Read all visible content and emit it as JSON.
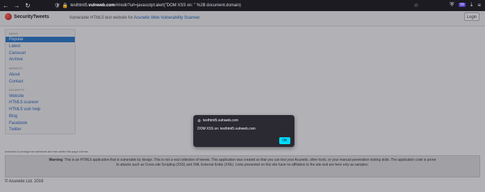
{
  "browser": {
    "nav": {
      "back": "←",
      "forward": "→",
      "reload": "↻"
    },
    "url": {
      "prefix": "testhtml5.",
      "host": "vulnweb.com",
      "path": "/#/redir?url=javascript:alert(\"DOM XSS on: \" %2B document.domain)"
    },
    "star": "☆",
    "right_icons": {
      "shield": "⛨",
      "extension_badge": "59",
      "download": "⤓",
      "menu": "≡"
    }
  },
  "site": {
    "logo_text": "SecurityTweets",
    "tagline_prefix": "Vulnerable HTML5 test website for",
    "tagline_link": "Acunetix Web Vulnerability Scanner.",
    "login_label": "Login"
  },
  "sidebar": {
    "news_heading": "NEWS",
    "news_items": [
      "Popular",
      "Latest",
      "Carousel",
      "Archive"
    ],
    "website_heading": "WEBSITE",
    "website_items": [
      "About",
      "Contact"
    ],
    "acunetix_heading": "ACUNETIX",
    "acunetix_items": [
      "Website",
      "HTML5 scanner",
      "HTML5 vuln help",
      "Blog",
      "Facebook",
      "Twitter"
    ]
  },
  "footer": {
    "fine_note": "unknown is coming from webkiosk and has visited this page 3 times.",
    "warning_label": "Warning",
    "warning_text": ": This is an HTML5 application that is vulnerable by design. This is not a real collection of tweets. This application was created so that you can test your Acunetix, other tools, or your manual penetration testing skills. The application code is prone to attacks such as Cross-site Scripting (XSS) and XML External Entity (XXE). Links presented on this site have no affiliation to the site and are here only as samples.",
    "copyright": "© Acunetix Ltd. 2019"
  },
  "dialog": {
    "globe": "⊕",
    "origin": "testhtml5.vulnweb.com",
    "message": "DOM XSS on: testhtml5.vulnweb.com",
    "ok_label": "OK"
  }
}
